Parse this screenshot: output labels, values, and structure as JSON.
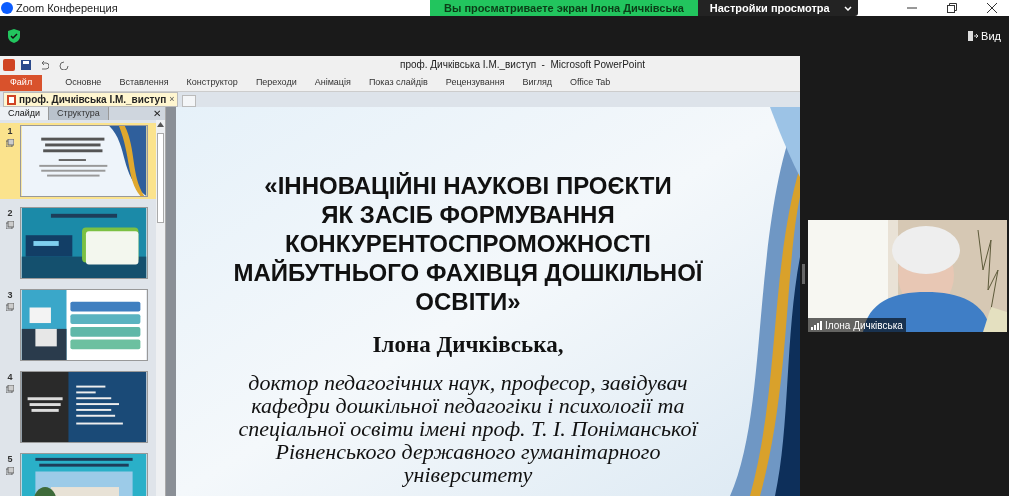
{
  "zoom": {
    "title": "Zoom Конференция",
    "banner": "Вы просматриваете экран Ілона Дичківська",
    "view_settings": "Настройки просмотра",
    "view_button": "Вид",
    "participant": "Ілона Дичківська"
  },
  "powerpoint": {
    "title": "проф. Дичківська І.М._виступ  -  Microsoft PowerPoint",
    "file_tab": "Файл",
    "ribbon_tabs": [
      "Основне",
      "Вставлення",
      "Конструктор",
      "Переходи",
      "Анімація",
      "Показ слайдів",
      "Рецензування",
      "Вигляд",
      "Office Tab"
    ],
    "document_tab": {
      "label": "проф. Дичківська І.М._виступ",
      "close": "×"
    },
    "pane_tabs": [
      {
        "label": "Слайди",
        "selected": true
      },
      {
        "label": "Структура",
        "selected": false
      }
    ],
    "pane_close": "✕",
    "thumbnails": [
      {
        "number": "1",
        "selected": true,
        "kind": "title"
      },
      {
        "number": "2",
        "selected": false,
        "kind": "teal"
      },
      {
        "number": "3",
        "selected": false,
        "kind": "list"
      },
      {
        "number": "4",
        "selected": false,
        "kind": "dark"
      },
      {
        "number": "5",
        "selected": false
      }
    ],
    "slide": {
      "title_lines": [
        "«ІННОВАЦІЙНІ НАУКОВІ ПРОЄКТИ",
        "ЯК ЗАСІБ ФОРМУВАННЯ",
        "КОНКУРЕНТОСПРОМОЖНОСТІ",
        "МАЙБУТНЬОГО ФАХІВЦЯ ДОШКІЛЬНОЇ",
        "ОСВІТИ»"
      ],
      "author": "Ілона Дичківська,",
      "subtitle_lines": [
        "доктор педагогічних наук, професор, завідувач",
        "кафедри дошкільної педагогіки і психології та",
        "спеціальної освіти  імені проф. Т. І. Поніманської",
        "Рівненського державного гуманітарного",
        "університету"
      ]
    }
  }
}
